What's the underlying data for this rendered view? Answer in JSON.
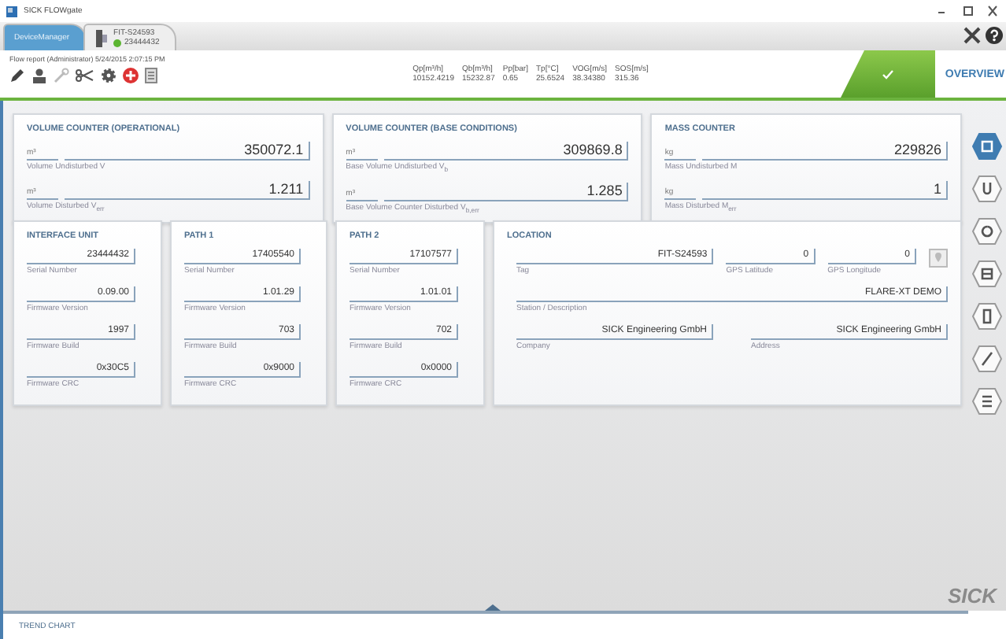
{
  "app": {
    "title": "SICK FLOWgate"
  },
  "tabs": [
    {
      "label": "DeviceManager",
      "selected": true
    },
    {
      "label": "FIT-S24593",
      "sublabel": "23444432",
      "color": "#5cb531",
      "selected": false
    }
  ],
  "report": "Flow report (Administrator) 5/24/2015 2:07:15 PM",
  "readings": {
    "headers": [
      "Qp[m³/h]",
      "Qb[m³/h]",
      "Pp[bar]",
      "Tp[°C]",
      "VOG[m/s]",
      "SOS[m/s]"
    ],
    "values": [
      "10152.4219",
      "15232.87",
      "0.65",
      "25.6524",
      "38.34380",
      "315.36"
    ]
  },
  "status": {
    "ok": true
  },
  "overview": "OVERVIEW",
  "counters": [
    {
      "title": "VOLUME COUNTER (OPERATIONAL)",
      "fields": [
        {
          "unit": "m³",
          "value": "350072.1",
          "label": "Volume Undisturbed V"
        },
        {
          "unit": "m³",
          "value": "1.211",
          "label": "Volume Disturbed V$_{err}$"
        }
      ]
    },
    {
      "title": "VOLUME COUNTER (BASE CONDITIONS)",
      "fields": [
        {
          "unit": "m³",
          "value": "309869.8",
          "label": "Base Volume Undisturbed V$_{b}$"
        },
        {
          "unit": "m³",
          "value": "1.285",
          "label": "Base Volume Counter Disturbed V$_{b,err}$"
        }
      ]
    },
    {
      "title": "MASS COUNTER",
      "fields": [
        {
          "unit": "kg",
          "value": "229826",
          "label": "Mass Undisturbed M"
        },
        {
          "unit": "kg",
          "value": "1",
          "label": "Mass Disturbed M$_{err}$"
        }
      ]
    }
  ],
  "devices": [
    {
      "title": "INTERFACE UNIT",
      "fields": [
        {
          "value": "23444432",
          "label": "Serial Number"
        },
        {
          "value": "0.09.00",
          "label": "Firmware Version"
        },
        {
          "value": "1997",
          "label": "Firmware Build"
        },
        {
          "value": "0x30C5",
          "label": "Firmware CRC"
        }
      ]
    },
    {
      "title": "PATH 1",
      "fields": [
        {
          "value": "17405540",
          "label": "Serial Number"
        },
        {
          "value": "1.01.29",
          "label": "Firmware Version"
        },
        {
          "value": "703",
          "label": "Firmware Build"
        },
        {
          "value": "0x9000",
          "label": "Firmware CRC"
        }
      ]
    },
    {
      "title": "PATH 2",
      "fields": [
        {
          "value": "17107577",
          "label": "Serial Number"
        },
        {
          "value": "1.01.01",
          "label": "Firmware Version"
        },
        {
          "value": "702",
          "label": "Firmware Build"
        },
        {
          "value": "0x0000",
          "label": "Firmware CRC"
        }
      ]
    }
  ],
  "location": {
    "title": "LOCATION",
    "tag": {
      "value": "FIT-S24593",
      "label": "Tag"
    },
    "gps": [
      {
        "value": "0",
        "label": "GPS Latitude"
      },
      {
        "value": "0",
        "label": "GPS Longitude"
      }
    ],
    "station": {
      "value": "FLARE-XT DEMO",
      "label": "Station / Description"
    },
    "company": {
      "value": "SICK Engineering GmbH",
      "label": "Company"
    },
    "address": {
      "value": "SICK Engineering GmbH",
      "label": "Address"
    }
  },
  "side_nav": [
    {
      "selected": true
    },
    {
      "selected": false
    },
    {
      "selected": false
    },
    {
      "selected": false
    },
    {
      "selected": false
    },
    {
      "selected": false
    },
    {
      "selected": false
    }
  ],
  "logo": "SICK",
  "trend_chart": {
    "title": "TREND CHART"
  }
}
